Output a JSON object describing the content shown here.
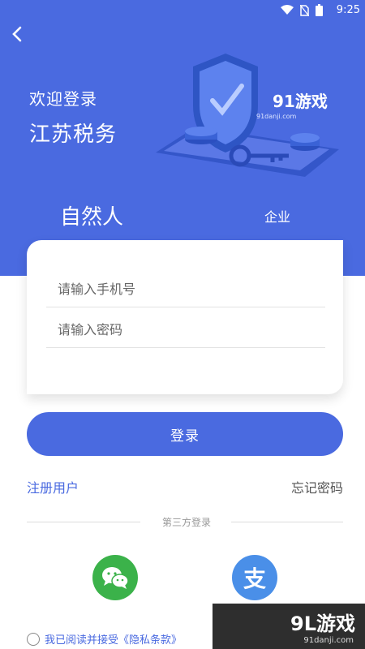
{
  "status_bar": {
    "time": "9:25"
  },
  "header": {
    "back_icon": "chevron-left-icon",
    "welcome": "欢迎登录",
    "title": "江苏税务",
    "illustration_text": "91游戏",
    "illustration_subtext": "91danji.com"
  },
  "tabs": {
    "person": "自然人",
    "company": "企业",
    "active": "person"
  },
  "form": {
    "phone_placeholder": "请输入手机号",
    "password_placeholder": "请输入密码"
  },
  "actions": {
    "login": "登录",
    "register": "注册用户",
    "forgot": "忘记密码"
  },
  "third_party": {
    "label": "第三方登录",
    "wechat_icon": "wechat-icon",
    "alipay_label": "支"
  },
  "agreement": {
    "text": "我已阅读并接受《隐私条款》"
  },
  "watermark": {
    "main": "9L游戏",
    "sub": "91danji.com"
  },
  "colors": {
    "primary": "#4a6ae0",
    "wechat": "#3bb24a",
    "alipay": "#4a8fe8"
  }
}
